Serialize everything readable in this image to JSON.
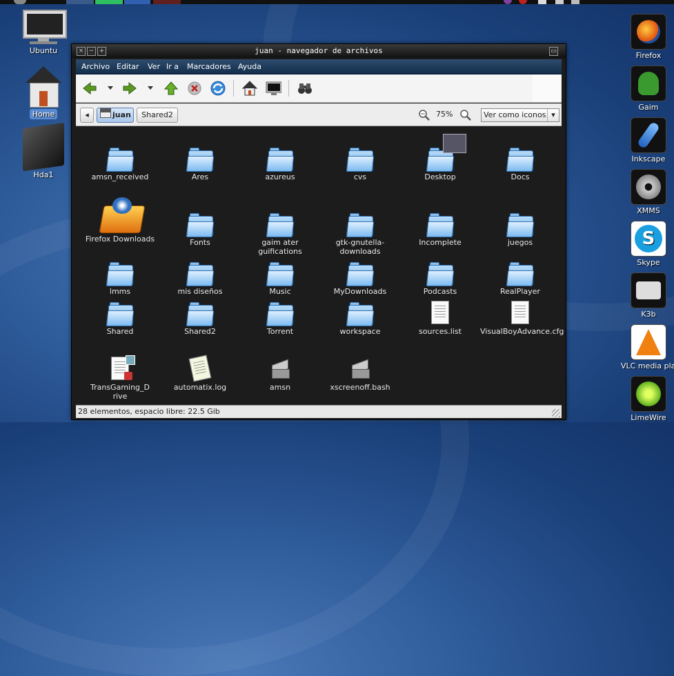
{
  "window": {
    "title": "juan - navegador de archivos"
  },
  "menu": [
    {
      "label": "Archivo"
    },
    {
      "label": "Editar"
    },
    {
      "label": "Ver"
    },
    {
      "label": "Ir a"
    },
    {
      "label": "Marcadores"
    },
    {
      "label": "Ayuda"
    }
  ],
  "toolbar": {
    "icons": [
      "back-arrow-icon",
      "forward-arrow-icon",
      "up-arrow-icon",
      "stop-icon",
      "reload-icon",
      "home-icon",
      "computer-icon",
      "search-binoculars-icon"
    ]
  },
  "location": {
    "current": "juan",
    "next": "Shared2",
    "zoom": "75%",
    "view_mode": "Ver como iconos"
  },
  "files": [
    {
      "name": "amsn_received",
      "type": "folder"
    },
    {
      "name": "Ares",
      "type": "folder"
    },
    {
      "name": "azureus",
      "type": "folder"
    },
    {
      "name": "cvs",
      "type": "folder"
    },
    {
      "name": "Desktop",
      "type": "folder-desktop"
    },
    {
      "name": "Docs",
      "type": "folder"
    },
    {
      "name": "Firefox Downloads",
      "type": "folder-firefox"
    },
    {
      "name": "Fonts",
      "type": "folder"
    },
    {
      "name": "gaim ater guifications",
      "type": "folder"
    },
    {
      "name": "gtk-gnutella-downloads",
      "type": "folder"
    },
    {
      "name": "Incomplete",
      "type": "folder"
    },
    {
      "name": "juegos",
      "type": "folder"
    },
    {
      "name": "lmms",
      "type": "folder"
    },
    {
      "name": "mis diseños",
      "type": "folder"
    },
    {
      "name": "Music",
      "type": "folder"
    },
    {
      "name": "MyDownloads",
      "type": "folder"
    },
    {
      "name": "Podcasts",
      "type": "folder"
    },
    {
      "name": "RealPlayer",
      "type": "folder"
    },
    {
      "name": "Shared",
      "type": "folder"
    },
    {
      "name": "Shared2",
      "type": "folder"
    },
    {
      "name": "Torrent",
      "type": "folder"
    },
    {
      "name": "workspace",
      "type": "folder"
    },
    {
      "name": "sources.list",
      "type": "text"
    },
    {
      "name": "VisualBoyAdvance.cfg",
      "type": "text"
    },
    {
      "name": "TransGaming_Drive",
      "type": "binary"
    },
    {
      "name": "automatix.log",
      "type": "log"
    },
    {
      "name": "amsn",
      "type": "exec"
    },
    {
      "name": "xscreenoff.bash",
      "type": "exec"
    }
  ],
  "status": "28 elementos, espacio libre: 22.5 Gib",
  "desktop_icons": [
    {
      "label": "Ubuntu"
    },
    {
      "label": "Home"
    },
    {
      "label": "Hda1"
    }
  ],
  "dock": [
    {
      "label": "Firefox"
    },
    {
      "label": "Gaim"
    },
    {
      "label": "Inkscape"
    },
    {
      "label": "XMMS"
    },
    {
      "label": "Skype"
    },
    {
      "label": "K3b"
    },
    {
      "label": "VLC media play"
    },
    {
      "label": "LimeWire"
    }
  ]
}
